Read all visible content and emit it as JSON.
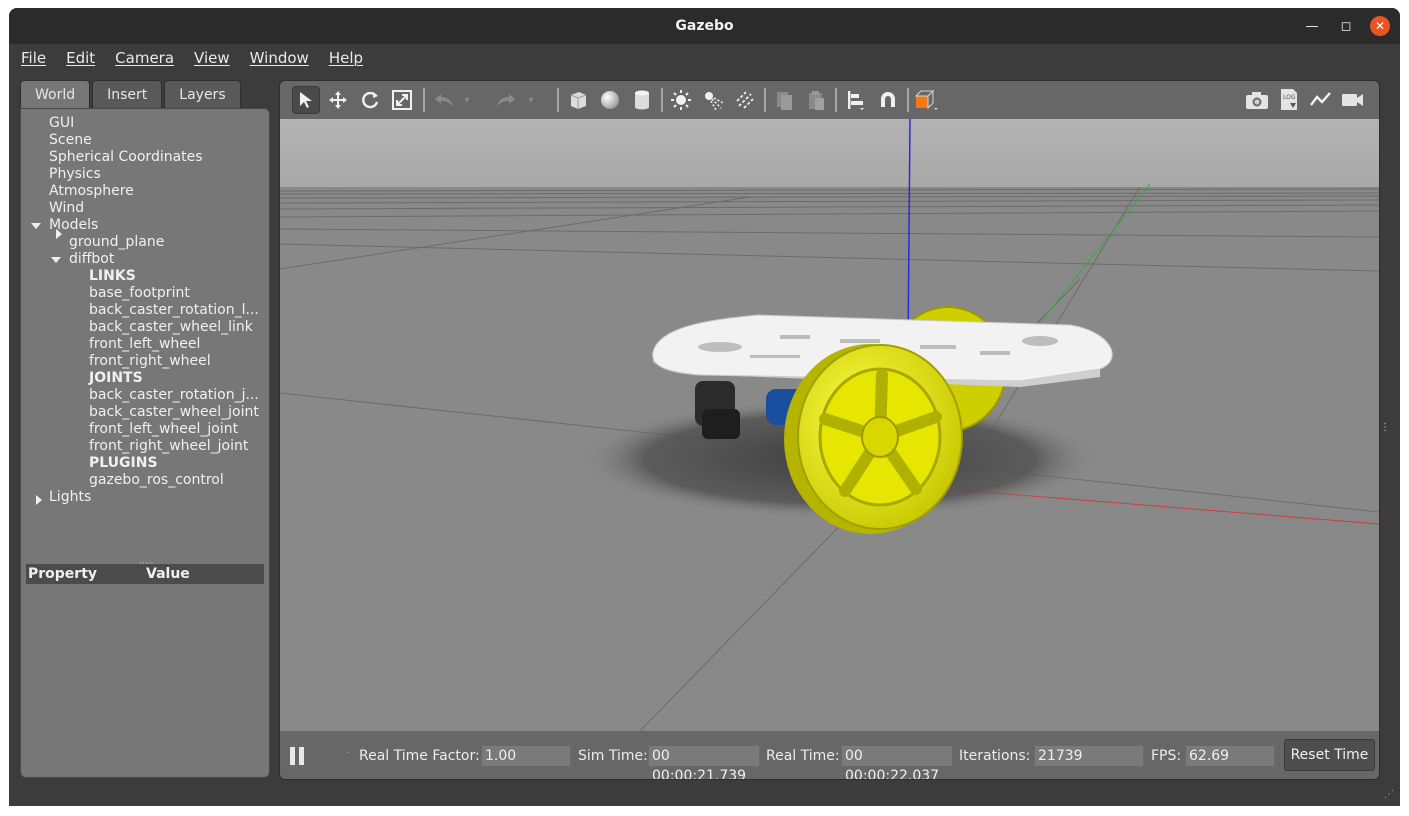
{
  "window": {
    "title": "Gazebo"
  },
  "menu": [
    "File",
    "Edit",
    "Camera",
    "View",
    "Window",
    "Help"
  ],
  "tabs": [
    "World",
    "Insert",
    "Layers"
  ],
  "tree": {
    "gui": "GUI",
    "scene": "Scene",
    "spherical": "Spherical Coordinates",
    "physics": "Physics",
    "atmosphere": "Atmosphere",
    "wind": "Wind",
    "models": "Models",
    "ground_plane": "ground_plane",
    "diffbot": "diffbot",
    "links_header": "LINKS",
    "links": [
      "base_footprint",
      "back_caster_rotation_l...",
      "back_caster_wheel_link",
      "front_left_wheel",
      "front_right_wheel"
    ],
    "joints_header": "JOINTS",
    "joints": [
      "back_caster_rotation_j...",
      "back_caster_wheel_joint",
      "front_left_wheel_joint",
      "front_right_wheel_joint"
    ],
    "plugins_header": "PLUGINS",
    "plugins": [
      "gazebo_ros_control"
    ],
    "lights": "Lights"
  },
  "properties": {
    "col_property": "Property",
    "col_value": "Value"
  },
  "toolbar": {
    "icons": [
      "select-arrow-icon",
      "translate-icon",
      "rotate-icon",
      "scale-icon",
      "undo-icon",
      "redo-icon",
      "box-icon",
      "sphere-icon",
      "cylinder-icon",
      "point-light-icon",
      "spot-light-icon",
      "directional-light-icon",
      "copy-icon",
      "paste-icon",
      "align-icon",
      "snap-icon",
      "view-angle-icon",
      "screenshot-icon",
      "log-icon",
      "plot-icon",
      "record-video-icon"
    ]
  },
  "status": {
    "rtf_label": "Real Time Factor:",
    "rtf_value": "1.00",
    "sim_label": "Sim Time:",
    "sim_value": "00 00:00:21.739",
    "real_label": "Real Time:",
    "real_value": "00 00:00:22.037",
    "iter_label": "Iterations:",
    "iter_value": "21739",
    "fps_label": "FPS:",
    "fps_value": "62.69",
    "reset_label": "Reset Time"
  },
  "colors": {
    "wheel": "#e6e600",
    "chassis": "#f2f2f2",
    "accent": "#e95420"
  }
}
